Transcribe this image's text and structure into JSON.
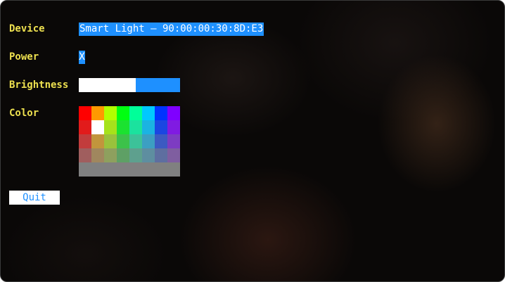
{
  "labels": {
    "device": "Device",
    "power": "Power",
    "brightness": "Brightness",
    "color": "Color"
  },
  "device": {
    "value": "Smart Light — 90:00:00:30:8D:E3"
  },
  "power": {
    "toggle": "X",
    "on": true
  },
  "brightness": {
    "level": 0.56,
    "fill_color": "#ffffff",
    "track_color": "#1e90ff"
  },
  "color_palette": {
    "selected": {
      "row": 1,
      "col": 1
    },
    "rows": [
      [
        "#ff0000",
        "#ff9900",
        "#b2ff00",
        "#00ff11",
        "#00ff99",
        "#00c8ff",
        "#0033ff",
        "#7f00ff"
      ],
      [
        "#e21b1b",
        "#ffffff",
        "#a6e21b",
        "#1be230",
        "#1be29e",
        "#1bb3e2",
        "#1b46e2",
        "#801be2"
      ],
      [
        "#c23c3c",
        "#c2953c",
        "#99c23c",
        "#3cc24a",
        "#3cc299",
        "#3c9fc2",
        "#3c5ac2",
        "#7d3cc2"
      ],
      [
        "#a05e5e",
        "#a0875e",
        "#8ea05e",
        "#5ea065",
        "#5ea08e",
        "#5e8ea0",
        "#5e6ea0",
        "#7f5ea0"
      ]
    ],
    "gray": "#808080"
  },
  "quit_button": {
    "label": "Quit"
  },
  "theme": {
    "accent": "#1e90ff",
    "label_color": "#ede04f"
  }
}
